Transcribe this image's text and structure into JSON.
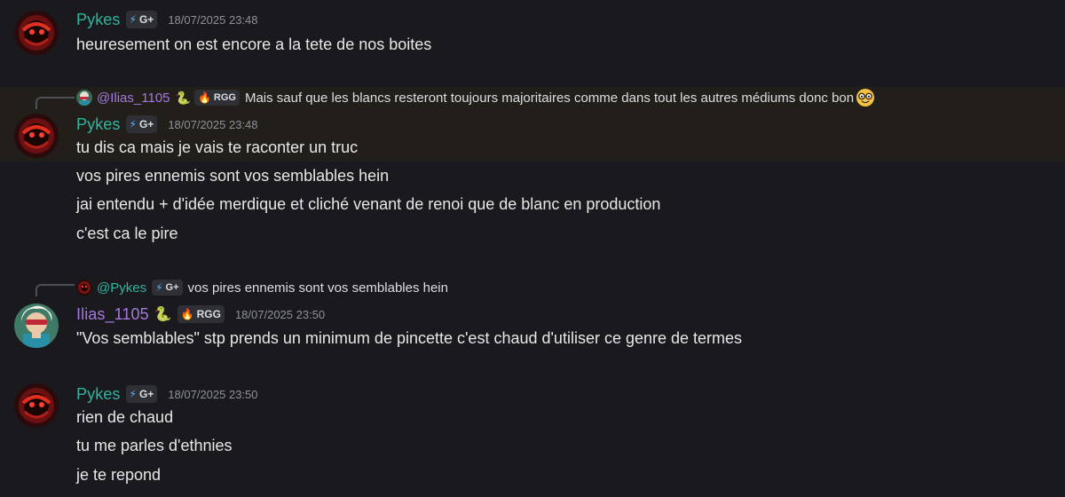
{
  "messages": [
    {
      "author": "Pykes",
      "tag": "G+",
      "timestamp": "18/07/2025 23:48",
      "lines": [
        "heuresement on est encore a la tete de nos boites"
      ]
    },
    {
      "reply": {
        "author": "@Ilias_1105",
        "tag": "RGG",
        "text": "Mais sauf que les blancs resteront toujours majoritaires comme dans tout les autres médiums donc bon"
      },
      "author": "Pykes",
      "tag": "G+",
      "timestamp": "18/07/2025 23:48",
      "lines": [
        "tu dis ca mais je vais te raconter un truc",
        "vos pires ennemis sont vos semblables hein",
        "jai entendu + d'idée merdique et cliché venant de renoi que de blanc en production",
        "c'est ca le pire"
      ]
    },
    {
      "reply": {
        "author": "@Pykes",
        "tag": "G+",
        "text": "vos pires ennemis sont vos semblables hein"
      },
      "author": "Ilias_1105",
      "tag": "RGG",
      "timestamp": "18/07/2025 23:50",
      "lines": [
        "\"Vos semblables\" stp prends un minimum de pincette c'est chaud d'utiliser ce genre de termes"
      ]
    },
    {
      "author": "Pykes",
      "tag": "G+",
      "timestamp": "18/07/2025 23:50",
      "lines": [
        "rien de chaud",
        "tu me parles d'ethnies",
        "je te repond"
      ]
    }
  ],
  "icons": {
    "bolt": "⚡",
    "flame": "🔥",
    "snake": "🐍",
    "nerd": "nerd-face-emoji"
  },
  "colors": {
    "background": "#1a1a1e",
    "highlight": "#221f1a",
    "pykes": "#2fb4a0",
    "ilias": "#a478e0",
    "timestamp": "#8e9297"
  }
}
